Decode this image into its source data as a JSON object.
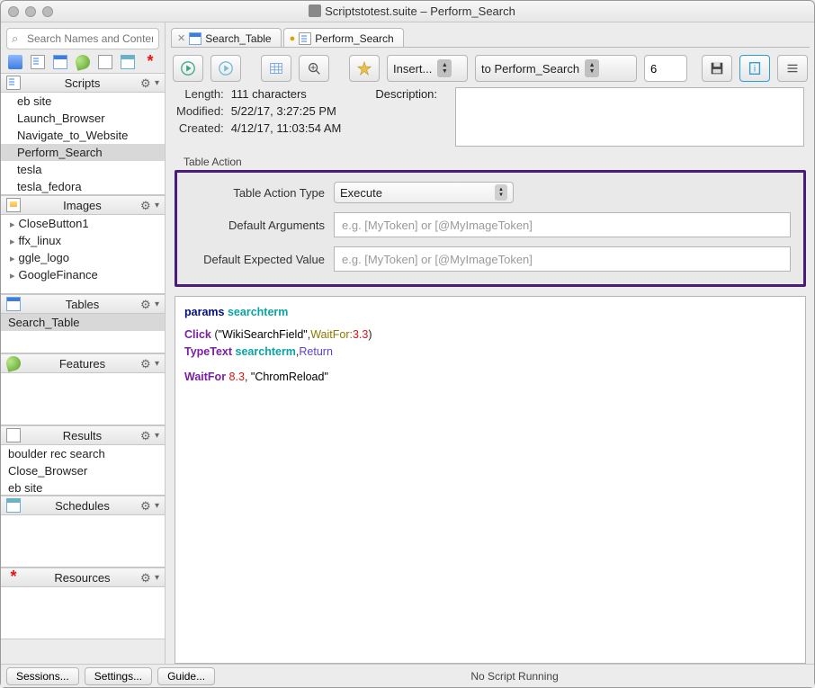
{
  "window": {
    "title": "Scriptstotest.suite – Perform_Search"
  },
  "tabs": [
    {
      "label": "Search_Table",
      "active": false
    },
    {
      "label": "Perform_Search",
      "active": true
    }
  ],
  "search": {
    "placeholder": "Search Names and Conten"
  },
  "sidebar": {
    "scripts": {
      "title": "Scripts",
      "items": [
        "eb site",
        "Launch_Browser",
        "Navigate_to_Website",
        "Perform_Search",
        "tesla",
        "tesla_fedora"
      ],
      "selected_index": 3
    },
    "images": {
      "title": "Images",
      "items": [
        "CloseButton1",
        "ffx_linux",
        "ggle_logo",
        "GoogleFinance"
      ]
    },
    "tables": {
      "title": "Tables",
      "items": [
        "Search_Table"
      ],
      "selected_index": 0
    },
    "features": {
      "title": "Features"
    },
    "results": {
      "title": "Results",
      "items": [
        "boulder rec search",
        "Close_Browser",
        "eb site"
      ]
    },
    "schedules": {
      "title": "Schedules"
    },
    "resources": {
      "title": "Resources"
    }
  },
  "toolbar": {
    "insert_label": "Insert...",
    "target_label": "to Perform_Search",
    "number_value": "6"
  },
  "meta": {
    "length_label": "Length:",
    "length_value": "111 characters",
    "modified_label": "Modified:",
    "modified_value": "5/22/17, 3:27:25 PM",
    "created_label": "Created:",
    "created_value": "4/12/17, 11:03:54 AM",
    "description_label": "Description:"
  },
  "table_action": {
    "legend": "Table Action",
    "type_label": "Table Action Type",
    "type_value": "Execute",
    "args_label": "Default Arguments",
    "args_placeholder": "e.g. [MyToken] or [@MyImageToken]",
    "expected_label": "Default Expected Value",
    "expected_placeholder": "e.g. [MyToken] or [@MyImageToken]"
  },
  "editor": {
    "params_kw": "params",
    "params_var": "searchterm",
    "click_kw": "Click",
    "click_args_open": " (",
    "click_str": "\"WikiSearchField\"",
    "click_comma": ",",
    "waitfor_colon": "WaitFor:",
    "click_num": "3.3",
    "click_close": ")",
    "typetext_kw": "TypeText",
    "typetext_var": "searchterm",
    "typetext_comma": ",",
    "return_kw": "Return",
    "waitfor_kw": "WaitFor",
    "waitfor_num": "8.3",
    "waitfor_comma": ", ",
    "waitfor_str": "\"ChromReload\""
  },
  "statusbar": {
    "sessions": "Sessions...",
    "settings": "Settings...",
    "guide": "Guide...",
    "status": "No Script Running"
  }
}
